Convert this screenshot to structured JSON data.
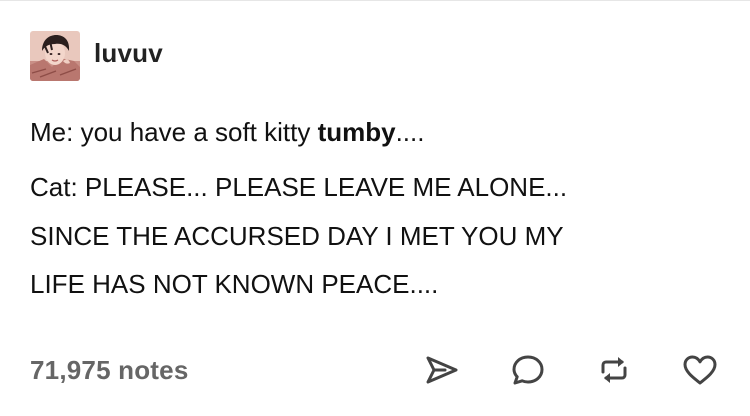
{
  "post": {
    "username": "luvuv",
    "avatar_icon": "avatar-photo-icon",
    "line1_regular": "Me: you have a soft kitty ",
    "line1_bold": "tumby",
    "line1_tail": "....",
    "para2_lines": [
      "Cat: PLEASE... PLEASE LEAVE ME ALONE...",
      "SINCE THE ACCURSED DAY I MET YOU MY",
      "LIFE HAS NOT KNOWN PEACE...."
    ]
  },
  "footer": {
    "notes": "71,975 notes",
    "actions": [
      {
        "name": "share",
        "icon": "share-icon"
      },
      {
        "name": "reply",
        "icon": "reply-icon"
      },
      {
        "name": "reblog",
        "icon": "reblog-icon"
      },
      {
        "name": "like",
        "icon": "heart-icon"
      }
    ]
  },
  "colors": {
    "text": "#111111",
    "notes": "#666666",
    "icon": "#444444",
    "divider": "#e6e6e6"
  }
}
